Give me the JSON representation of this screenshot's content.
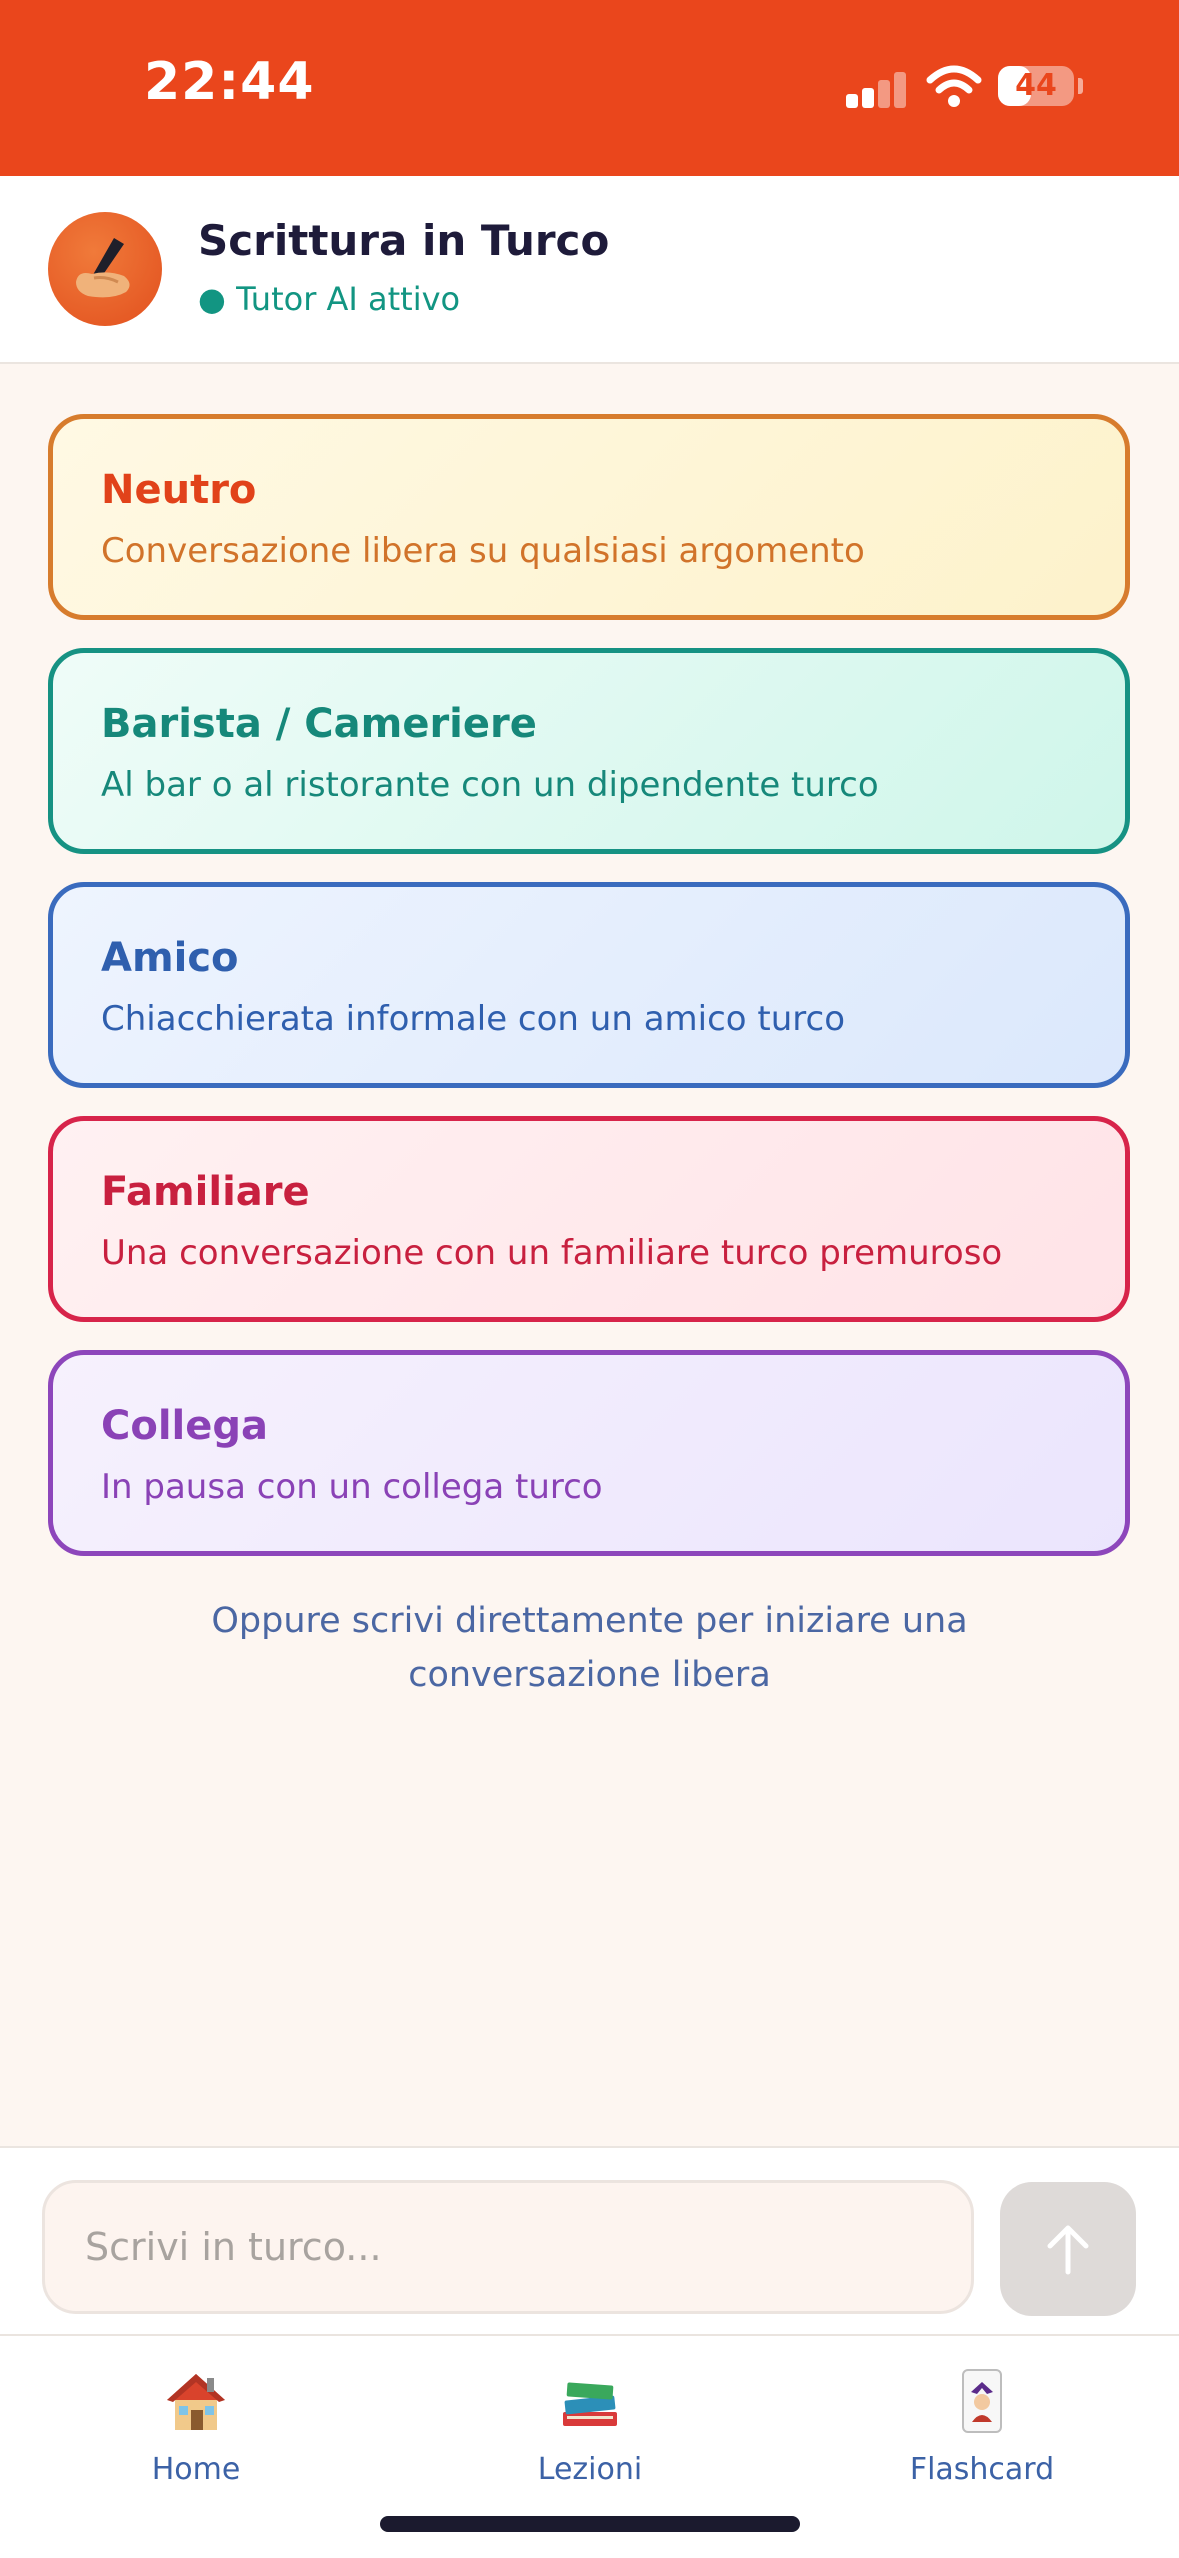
{
  "status_bar": {
    "time": "22:44",
    "battery": "44",
    "battery_level": 0.44
  },
  "header": {
    "title": "Scrittura in Turco",
    "status": "● Tutor AI attivo",
    "avatar_icon": "writing-hand-icon"
  },
  "scenarios": [
    {
      "title": "Neutro",
      "description": "Conversazione libera su qualsiasi argomento"
    },
    {
      "title": "Barista / Cameriere",
      "description": "Al bar o al ristorante con un dipendente turco"
    },
    {
      "title": "Amico",
      "description": "Chiacchierata informale con un amico turco"
    },
    {
      "title": "Familiare",
      "description": "Una conversazione con un familiare turco premuroso"
    },
    {
      "title": "Collega",
      "description": "In pausa con un collega turco"
    }
  ],
  "hint": "Oppure scrivi direttamente per iniziare una conversazione libera",
  "composer": {
    "value": "",
    "placeholder": "Scrivi in turco...",
    "send_icon": "arrow-up-icon"
  },
  "tabs": [
    {
      "label": "Home",
      "icon": "house-icon"
    },
    {
      "label": "Lezioni",
      "icon": "books-icon"
    },
    {
      "label": "Flashcard",
      "icon": "joker-card-icon"
    }
  ],
  "colors": {
    "accent": "#ea461c",
    "neutro": "#d77c2d",
    "barista": "#169283",
    "amico": "#3a6bbe",
    "familiare": "#d7244a",
    "collega": "#8d46bb"
  }
}
